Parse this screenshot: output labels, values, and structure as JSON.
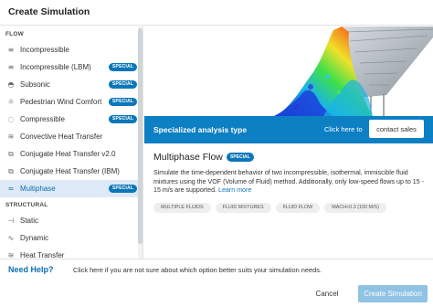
{
  "header": {
    "title": "Create Simulation"
  },
  "sidebar": {
    "sections": [
      {
        "label": "FLOW"
      },
      {
        "label": "STRUCTURAL"
      }
    ],
    "flow_items": [
      {
        "label": "Incompressible",
        "icon": "flow-lines-icon",
        "badge": ""
      },
      {
        "label": "Incompressible (LBM)",
        "icon": "flow-lines-icon",
        "badge": "SPECIAL"
      },
      {
        "label": "Subsonic",
        "icon": "subsonic-icon",
        "badge": "SPECIAL"
      },
      {
        "label": "Pedestrian Wind Comfort",
        "icon": "wind-icon",
        "badge": "SPECIAL"
      },
      {
        "label": "Compressible",
        "icon": "compressible-icon",
        "badge": "SPECIAL"
      },
      {
        "label": "Convective Heat Transfer",
        "icon": "heat-icon",
        "badge": ""
      },
      {
        "label": "Conjugate Heat Transfer v2.0",
        "icon": "conjugate-heat-icon",
        "badge": ""
      },
      {
        "label": "Conjugate Heat Transfer (IBM)",
        "icon": "conjugate-heat-icon",
        "badge": ""
      },
      {
        "label": "Multiphase",
        "icon": "multiphase-icon",
        "badge": "SPECIAL",
        "active": true
      }
    ],
    "structural_items": [
      {
        "label": "Static",
        "icon": "static-icon",
        "badge": ""
      },
      {
        "label": "Dynamic",
        "icon": "dynamic-icon",
        "badge": ""
      },
      {
        "label": "Heat Transfer",
        "icon": "heat-icon",
        "badge": ""
      }
    ]
  },
  "banner": {
    "title": "Specialized analysis type",
    "click_here": "Click here to",
    "contact_label": "contact sales"
  },
  "detail": {
    "title": "Multiphase Flow",
    "badge": "SPECIAL",
    "description": "Simulate the time-dependent behavior of two incompressible, isothermal, immiscible fluid mixtures using the VOF (Volume of Fluid) method. Additionally, only low-speed flows up to 15 - 15 m/s are supported.",
    "learn_more": "Learn more",
    "tags": [
      "MULTIPLE FLUIDS",
      "FLUID MIXTURES",
      "FLUID FLOW",
      "MACH<0.3 (100 M/S)"
    ]
  },
  "footer": {
    "need_help": "Need Help?",
    "help_text": "Click here if you are not sure about which option better suits your simulation needs.",
    "cancel_label": "Cancel",
    "create_label": "Create Simulation"
  },
  "colors": {
    "accent": "#0d7fc3",
    "badge": "#0b77b8",
    "active_item_bg": "#dde9f6",
    "create_disabled": "#8fc2e3"
  }
}
